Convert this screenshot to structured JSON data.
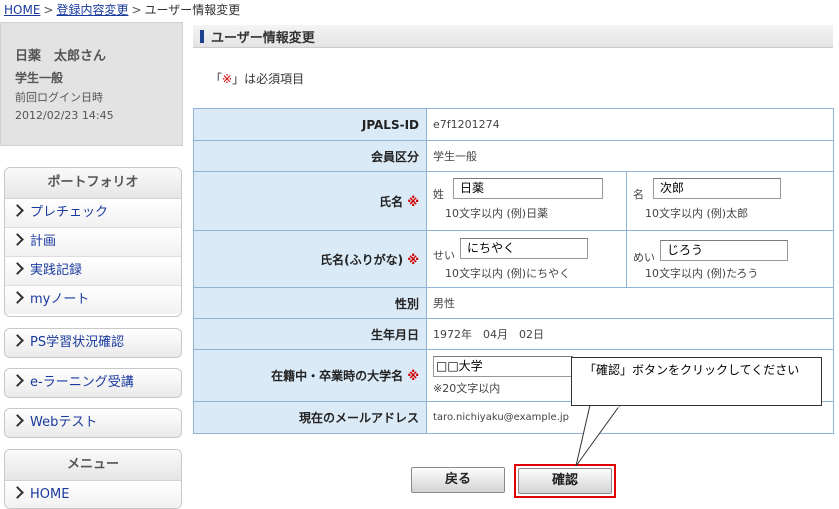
{
  "breadcrumb": {
    "home": "HOME",
    "registration": "登録内容変更",
    "current": "ユーザー情報変更",
    "separator": ">"
  },
  "user": {
    "name": "日薬　太郎さん",
    "type": "学生一般",
    "last_login_label": "前回ログイン日時",
    "last_login_value": "2012/02/23 14:45"
  },
  "sidebar": {
    "portfolio_title": "ポートフォリオ",
    "portfolio_items": [
      {
        "label": "プレチェック"
      },
      {
        "label": "計画"
      },
      {
        "label": "実践記録"
      },
      {
        "label": "myノート"
      }
    ],
    "ps_label": "PS学習状況確認",
    "elearning_label": "e-ラーニング受講",
    "webtest_label": "Webテスト",
    "menu_title": "メニュー",
    "menu_items": [
      {
        "label": "HOME"
      }
    ]
  },
  "page": {
    "title": "ユーザー情報変更",
    "req_note_pre": "「",
    "req_mark": "※",
    "req_note_post": "」は必須項目"
  },
  "form": {
    "jpals_label": "JPALS-ID",
    "jpals_value": "e7f1201274",
    "member_label": "会員区分",
    "member_value": "学生一般",
    "name_label": "氏名",
    "sei_prefix": "姓",
    "sei_value": "日薬",
    "sei_hint": "10文字以内 (例)日薬",
    "mei_prefix": "名",
    "mei_value": "次郎",
    "mei_hint": "10文字以内 (例)太郎",
    "kana_label": "氏名(ふりがな)",
    "sei_kana_prefix": "せい",
    "sei_kana_value": "にちやく",
    "sei_kana_hint": "10文字以内 (例)にちやく",
    "mei_kana_prefix": "めい",
    "mei_kana_value": "じろう",
    "mei_kana_hint": "10文字以内 (例)たろう",
    "gender_label": "性別",
    "gender_value": "男性",
    "birth_label": "生年月日",
    "birth_value": "1972年　04月　02日",
    "univ_label": "在籍中・卒業時の大学名",
    "univ_value": "□□大学",
    "univ_hint": "※20文字以内",
    "email_label": "現在のメールアドレス",
    "email_value": "taro.nichiyaku@example.jp",
    "required_mark": "※"
  },
  "buttons": {
    "back": "戻る",
    "confirm": "確認"
  },
  "callout": {
    "text": "「確認」ボタンをクリックしてください"
  },
  "colors": {
    "label_bg": "#dbeaf7",
    "table_border": "#8fb4d6",
    "link": "#1a3a9e",
    "required": "#d10000",
    "highlight": "#e00000"
  }
}
